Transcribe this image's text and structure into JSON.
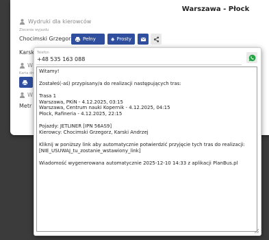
{
  "header": {
    "route_title": "Warszawa - Płock"
  },
  "printouts": {
    "title": "Wydruki dla kierowców",
    "departure_label": "Zlecenie wyjazdu",
    "driver_1": "Chocimski Grzegorz",
    "btn_full": "Pełny",
    "btn_simple": "Prosty",
    "driver_2_partial": "Karski",
    "card_label_partial": "Karta dro",
    "section_w1": "W",
    "section_w2": "W",
    "metro_partial": "Metr"
  },
  "popup": {
    "phone_label": "Telefon",
    "phone_value": "+48 535 163 088",
    "message": "Witamy!\n\nZostałeś(-aś) przypisany/a do realizacji następujących tras:\n\nTrasa 1\nWarszawa, PKiN - 4.12.2025, 03:15\nWarszawa, Centrum nauki Kopernik - 4.12.2025, 04:15\nPłock, Rafineria - 4.12.2025, 22:15\n\nPojazdy: JETLINER [IPN 56AS9]\nKierowcy: Chocimski Grzegorz, Karski Andrzej\n\nKliknij w poniższy link aby automatycznie potwierdzić przyjęcie tych tras do realizacji:\n[NIE_USUWAJ_tu_zostanie_wstawiony_link]\n\nWiadomość wygenerowana automatycznie 2025-12-10 14:33 z aplikacji PlanBus.pl"
  },
  "colors": {
    "button_blue": "#2f4f9e",
    "whatsapp_green": "#25a244"
  },
  "icons": [
    "user-icon",
    "printer-icon",
    "envelope-icon",
    "share-icon",
    "whatsapp-icon"
  ]
}
